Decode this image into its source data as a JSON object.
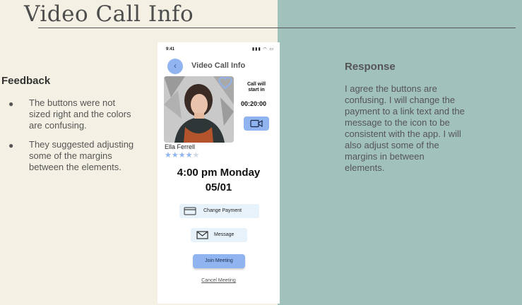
{
  "slide": {
    "title": "Video Call Info",
    "feedback": {
      "heading": "Feedback",
      "items": [
        "The buttons were not sized right and the colors are confusing.",
        "They suggested adjusting some of the margins between the elements."
      ]
    },
    "response": {
      "heading": "Response",
      "text": "I agree the buttons are confusing. I will change the payment to a link text and the message to the icon to be consistent with the app. I will also adjust some of the margins in between elements."
    },
    "colors": {
      "left_bg": "#f4f1e4",
      "right_bg": "#a1c1bd",
      "accent": "#8fb4f0"
    }
  },
  "phone": {
    "status_time": "9:41",
    "screen_title": "Video Call Info",
    "call_start_label": "Call will start in",
    "call_timer": "00:20:00",
    "person_name": "Ella Ferrell",
    "rating": {
      "filled": 4,
      "total": 5
    },
    "date_line1": "4:00 pm Monday",
    "date_line2": "05/01",
    "change_payment_label": "Change Payment",
    "message_label": "Message",
    "join_label": "Join Meeting",
    "cancel_label": "Cancel Meeting",
    "icons": [
      "back-arrow-icon",
      "heart-icon",
      "video-camera-icon",
      "credit-card-icon",
      "envelope-icon",
      "star-icon"
    ]
  }
}
